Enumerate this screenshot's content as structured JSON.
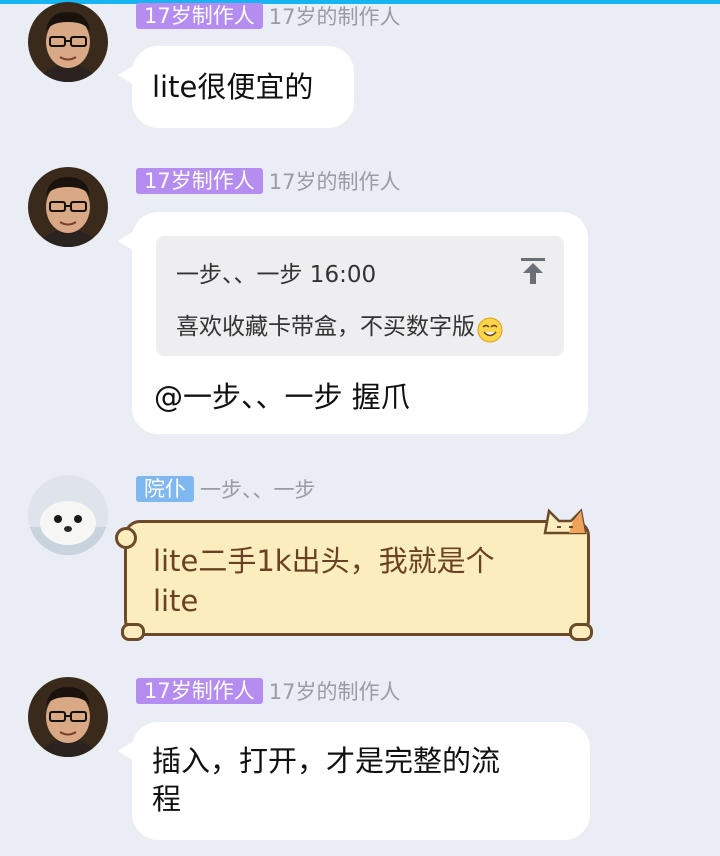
{
  "messages": [
    {
      "tag": "17岁制作人",
      "nickname": "17岁的制作人",
      "text": "lite很便宜的"
    },
    {
      "tag": "17岁制作人",
      "nickname": "17岁的制作人",
      "quote": {
        "header": "一步、、一步 16:00",
        "body": "喜欢收藏卡带盒，不买数字版"
      },
      "text": "@一步、、一步 握爪"
    },
    {
      "tag": "院仆",
      "nickname": "一步、、一步",
      "text_line1": "lite二手1k出头，我就是个",
      "text_line2": "lite"
    },
    {
      "tag": "17岁制作人",
      "nickname": "17岁的制作人",
      "text_line1": "插入，打开，才是完整的流",
      "text_line2": "程"
    }
  ],
  "colors": {
    "tag_purple": "#b58cf0",
    "tag_blue": "#7fb7f1",
    "background": "#eaedf4",
    "cat_bubble": "#fcedbe"
  },
  "icons": [
    "avatar-man",
    "avatar-seal",
    "jump-to-top-icon",
    "smile-emoji-icon",
    "cat-decoration-icon"
  ]
}
